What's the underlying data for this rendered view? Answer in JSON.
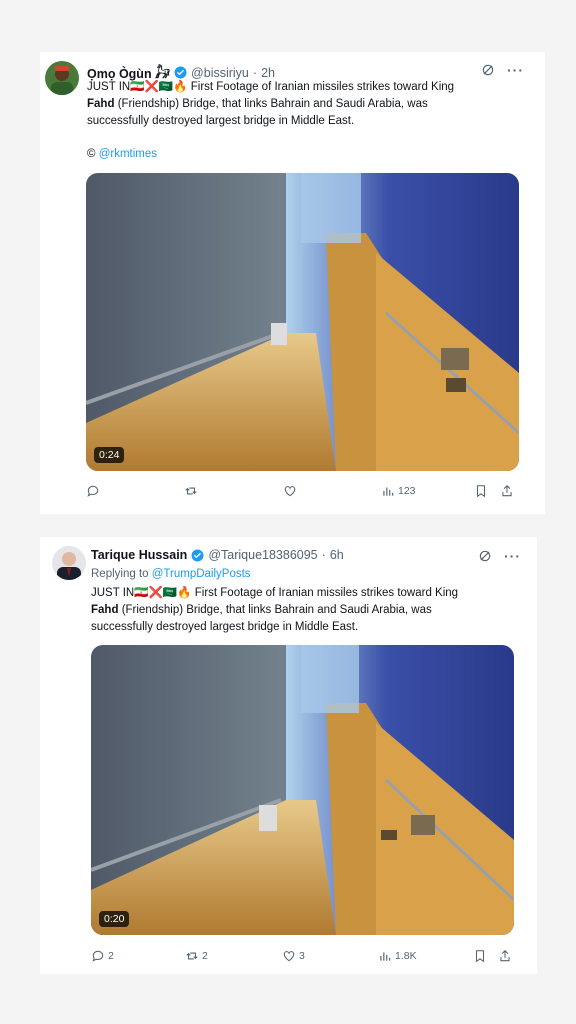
{
  "tweets": [
    {
      "name": "Ọmọ Ògùn 𓃗",
      "handle": "@bissiriyu",
      "time": "2h",
      "reply_prefix": "",
      "reply_handle": "",
      "text_prefix": "JUST IN",
      "text_emojis": "🇮🇷❌🇸🇦🔥",
      "text_line1_rest": "First Footage of Iranian missiles strikes toward King",
      "text_bold": "Fahd",
      "text_line2_rest": "(Friendship) Bridge, that links Bahrain and Saudi Arabia, was",
      "text_line3": "successfully destroyed largest bridge in Middle East.",
      "credit_symbol": "©",
      "credit_handle": "@rkmtimes",
      "duration": "0:24",
      "replies": "",
      "retweets": "",
      "likes": "",
      "views": "123"
    },
    {
      "name": "Tarique Hussain",
      "handle": "@Tarique18386095",
      "time": "6h",
      "reply_prefix": "Replying to",
      "reply_handle": "@TrumpDailyPosts",
      "text_prefix": "JUST IN",
      "text_emojis": "🇮🇷❌🇸🇦🔥",
      "text_line1_rest": "First Footage of Iranian missiles strikes toward King",
      "text_bold": "Fahd",
      "text_line2_rest": "(Friendship) Bridge, that links Bahrain and Saudi Arabia, was",
      "text_line3": "successfully destroyed largest bridge in Middle East.",
      "credit_symbol": "",
      "credit_handle": "",
      "duration": "0:20",
      "replies": "2",
      "retweets": "2",
      "likes": "3",
      "views": "1.8K"
    }
  ],
  "icons": {
    "verified_color": "#1d9bf0",
    "grok_icon": "grok-icon",
    "more_icon": "more-icon"
  },
  "colors": {
    "link": "#1d9bf0",
    "muted": "#536471",
    "background": "#f4f4f5"
  }
}
